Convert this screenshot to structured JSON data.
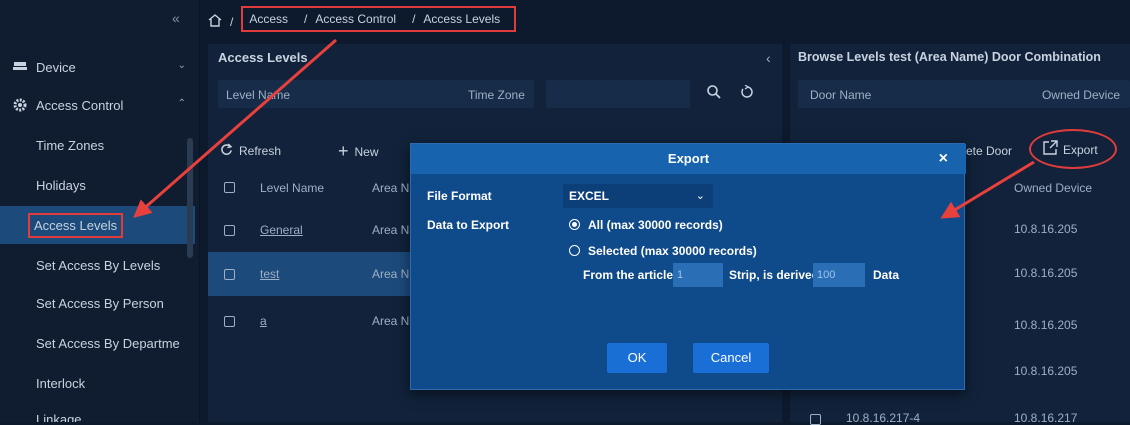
{
  "sidebar": {
    "collapse_glyph": "«",
    "device": "Device",
    "access_control": "Access Control",
    "items": [
      "Time Zones",
      "Holidays",
      "Access Levels",
      "Set Access By Levels",
      "Set Access By Person",
      "Set Access By Departme",
      "Interlock",
      "Linkage"
    ]
  },
  "breadcrumb": {
    "home_sep": "/",
    "items": [
      "Access",
      "Access Control",
      "Access Levels"
    ],
    "sep": "/"
  },
  "levels": {
    "title": "Access Levels",
    "collapse_glyph": "‹",
    "level_name_ph": "Level Name",
    "time_zone_ph": "Time Zone",
    "refresh": "Refresh",
    "new": "New",
    "col_level": "Level Name",
    "col_area": "Area N",
    "rows": [
      {
        "name": "General",
        "area": "Area N"
      },
      {
        "name": "test",
        "area": "Area N"
      },
      {
        "name": "a",
        "area": "Area N"
      }
    ]
  },
  "doors": {
    "title": "Browse Levels test  (Area Name)  Door Combination",
    "door_name_ph": "Door Name",
    "owned_device_ph": "Owned Device",
    "delete_door": "ete Door",
    "export": "Export",
    "col_owned": "Owned Device",
    "rows": [
      {
        "door": "",
        "device": "10.8.16.205"
      },
      {
        "door": "",
        "device": "10.8.16.205"
      },
      {
        "door": "",
        "device": "10.8.16.205"
      },
      {
        "door": "",
        "device": "10.8.16.205"
      },
      {
        "door": "10.8.16.217-4",
        "device": "10.8.16.217"
      }
    ]
  },
  "modal": {
    "title": "Export",
    "close": "×",
    "file_format_label": "File Format",
    "file_format_value": "EXCEL",
    "data_label": "Data to Export",
    "opt_all": "All (max 30000 records)",
    "opt_selected": "Selected (max 30000 records)",
    "from_text": "From the article",
    "from_value": "1",
    "strip_text": "Strip, is derived",
    "strip_value": "100",
    "data_text": "Data",
    "ok": "OK",
    "cancel": "Cancel"
  },
  "colors": {
    "accent": "#1a6fd6",
    "annotation": "#e03c3c",
    "active": "#1c4a7a"
  }
}
